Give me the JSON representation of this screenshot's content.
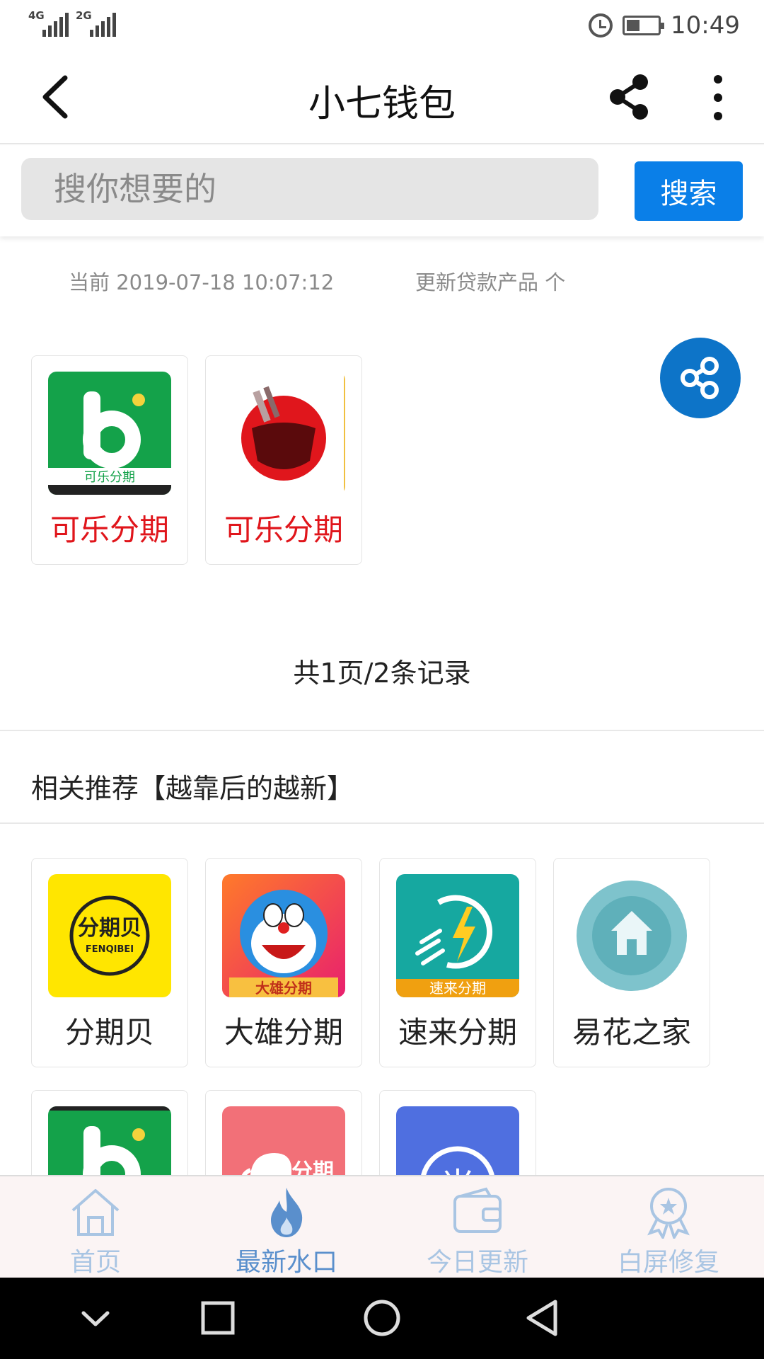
{
  "status_bar": {
    "signal_1_label": "4G",
    "signal_2_label": "2G",
    "time": "10:49"
  },
  "app_bar": {
    "title": "小七钱包"
  },
  "search": {
    "placeholder": "搜你想要的",
    "button_label": "搜索"
  },
  "info": {
    "current_label": "当前 2019-07-18 10:07:12",
    "update_label": "更新贷款产品 个"
  },
  "results": [
    {
      "name": "可乐分期",
      "icon": "kele-b-logo-icon",
      "icon_caption": "可乐分期"
    },
    {
      "name": "可乐分期",
      "icon": "cola-glass-logo-icon"
    }
  ],
  "pager": {
    "text": "共1页/2条记录"
  },
  "recommend": {
    "title": "相关推荐【越靠后的越新】",
    "items": [
      {
        "name": "分期贝",
        "icon": "fenqibei-logo-icon",
        "icon_caption": "FENQIBEI"
      },
      {
        "name": "大雄分期",
        "icon": "daxiong-doraemon-logo-icon",
        "icon_caption": "大雄分期"
      },
      {
        "name": "速来分期",
        "icon": "sulai-lightning-logo-icon",
        "icon_caption": "速来分期"
      },
      {
        "name": "易花之家",
        "icon": "yihua-house-logo-icon"
      },
      {
        "name": "",
        "icon": "kele-b-logo-icon"
      },
      {
        "name": "",
        "icon": "elephant-fenqi-logo-icon",
        "icon_caption": "分期"
      },
      {
        "name": "",
        "icon": "mi-logo-icon",
        "icon_caption": "米"
      }
    ]
  },
  "tab_bar": {
    "tabs": [
      {
        "label": "首页",
        "icon": "home-icon",
        "active": false
      },
      {
        "label": "最新水口",
        "icon": "flame-icon",
        "active": true
      },
      {
        "label": "今日更新",
        "icon": "wallet-icon",
        "active": false
      },
      {
        "label": "白屏修复",
        "icon": "award-badge-icon",
        "active": false
      }
    ]
  },
  "colors": {
    "accent_blue": "#0a7fe8",
    "float_share_blue": "#0d74c8",
    "red_name": "#e0151b",
    "tab_inactive": "#a9c5e3",
    "tab_active": "#5a8fcc"
  }
}
